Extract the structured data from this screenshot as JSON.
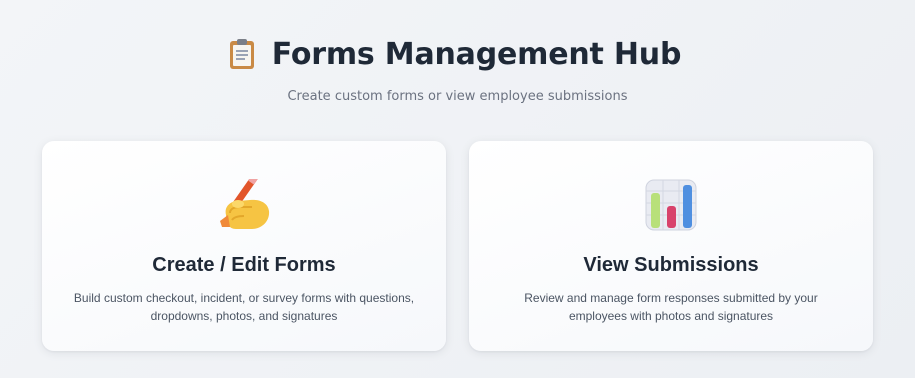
{
  "header": {
    "icon": "clipboard-icon",
    "title": "Forms Management Hub",
    "subtitle": "Create custom forms or view employee submissions"
  },
  "cards": [
    {
      "icon": "writing-hand-icon",
      "title": "Create / Edit Forms",
      "description": "Build custom checkout, incident, or survey forms with questions, dropdowns, photos, and signatures"
    },
    {
      "icon": "bar-chart-icon",
      "title": "View Submissions",
      "description": "Review and manage form responses submitted by your employees with photos and signatures"
    }
  ],
  "colors": {
    "background": "#eef1f5",
    "title_text": "#1f2937",
    "muted_text": "#6b7280",
    "card_bg": "#ffffff"
  }
}
